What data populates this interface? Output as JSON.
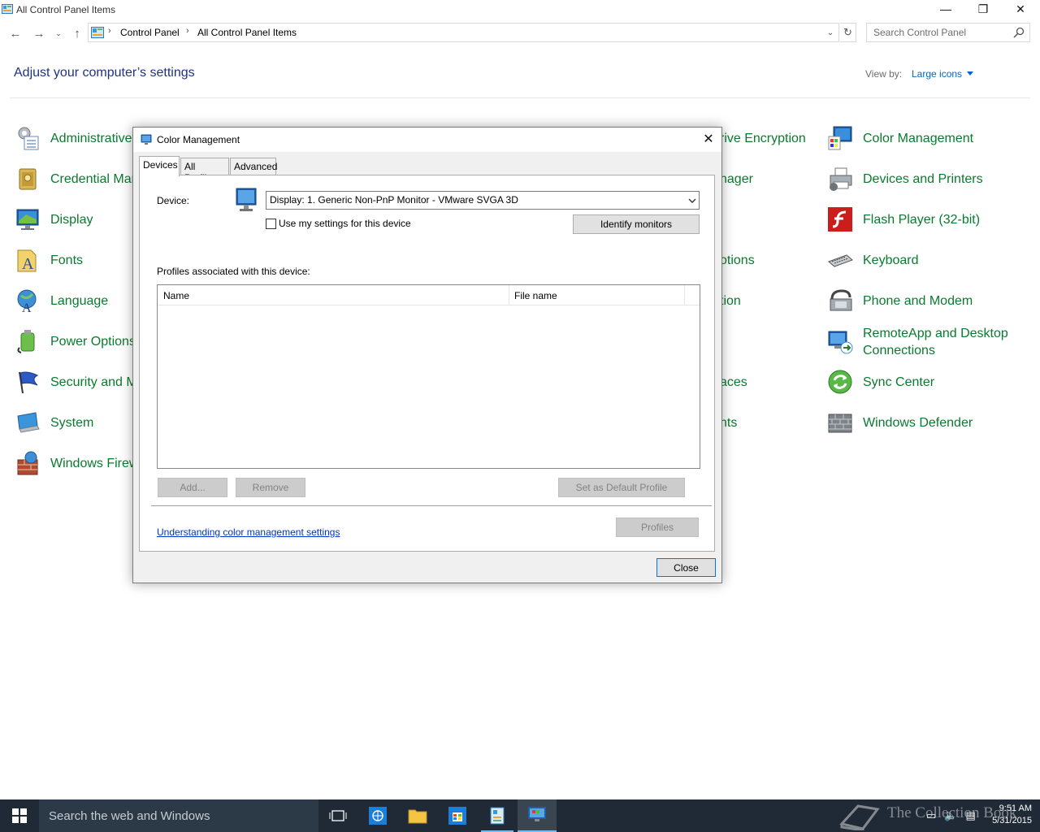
{
  "window": {
    "title": "All Control Panel Items",
    "controls": {
      "minimize": "—",
      "maximize": "❐",
      "close": "✕"
    }
  },
  "address": {
    "crumbs": [
      "Control Panel",
      "All Control Panel Items"
    ],
    "search_placeholder": "Search Control Panel"
  },
  "header": {
    "title": "Adjust your computer’s settings",
    "view_by_label": "View by:",
    "view_by_value": "Large icons"
  },
  "items": {
    "col1": [
      "Administrative",
      "Credential Man",
      "Display",
      "Fonts",
      "Language",
      "Power Options",
      "Security and M",
      "System",
      "Windows Firew"
    ],
    "col3": [
      "rive Encryption",
      "nager",
      "",
      "otions",
      "tion",
      "",
      "aces",
      "nts"
    ],
    "col4": [
      "Color Management",
      "Devices and Printers",
      "Flash Player (32-bit)",
      "Keyboard",
      "Phone and Modem",
      "RemoteApp and Desktop Connections",
      "Sync Center",
      "Windows Defender"
    ]
  },
  "dialog": {
    "title": "Color Management",
    "tabs": [
      "Devices",
      "All Profiles",
      "Advanced"
    ],
    "device_label": "Device:",
    "device_value": "Display: 1. Generic Non-PnP Monitor - VMware SVGA 3D",
    "use_settings_label": "Use my settings for this device",
    "identify_button": "Identify monitors",
    "profiles_assoc_label": "Profiles associated with this device:",
    "columns": [
      "Name",
      "File name"
    ],
    "add_button": "Add...",
    "remove_button": "Remove",
    "set_default_button": "Set as Default Profile",
    "profiles_button": "Profiles",
    "help_link": "Understanding color management settings",
    "close_button": "Close"
  },
  "taskbar": {
    "search_text": "Search the web and Windows",
    "time": "9:51 AM",
    "date": "5/31/2015"
  },
  "watermark": "The Collection Book",
  "colors": {
    "link_green": "#0a7a2e",
    "heading_blue": "#1e3287",
    "taskbar": "#1f2a36"
  }
}
